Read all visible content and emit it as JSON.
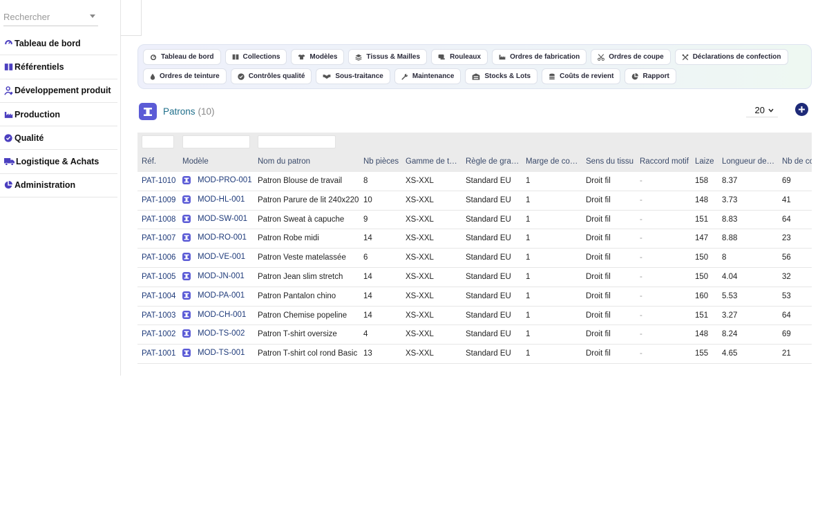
{
  "sidebar": {
    "search_placeholder": "Rechercher",
    "items": [
      {
        "label": "Tableau de bord",
        "icon": "gauge-icon"
      },
      {
        "label": "Référentiels",
        "icon": "book-icon"
      },
      {
        "label": "Développement produit",
        "icon": "user-gear-icon"
      },
      {
        "label": "Production",
        "icon": "industry-icon"
      },
      {
        "label": "Qualité",
        "icon": "check-circle-icon"
      },
      {
        "label": "Logistique & Achats",
        "icon": "truck-icon"
      },
      {
        "label": "Administration",
        "icon": "chart-pie-icon"
      }
    ]
  },
  "toolbar": {
    "row1": [
      {
        "label": "Tableau de bord",
        "icon": "gauge-icon"
      },
      {
        "label": "Collections",
        "icon": "book-icon"
      },
      {
        "label": "Modèles",
        "icon": "shirt-icon"
      },
      {
        "label": "Tissus & Mailles",
        "icon": "layers-icon"
      },
      {
        "label": "Rouleaux",
        "icon": "roll-icon"
      },
      {
        "label": "Ordres de fabrication",
        "icon": "industry-icon"
      },
      {
        "label": "Ordres de coupe",
        "icon": "scissors-icon"
      },
      {
        "label": "Déclarations de confection",
        "icon": "tools-icon"
      }
    ],
    "row2": [
      {
        "label": "Ordres de teinture",
        "icon": "droplet-icon"
      },
      {
        "label": "Contrôles qualité",
        "icon": "check-circle-icon"
      },
      {
        "label": "Sous-traitance",
        "icon": "handshake-icon"
      },
      {
        "label": "Maintenance",
        "icon": "wrench-icon"
      },
      {
        "label": "Stocks & Lots",
        "icon": "warehouse-icon"
      },
      {
        "label": "Coûts de revient",
        "icon": "coins-icon"
      },
      {
        "label": "Rapport",
        "icon": "chart-pie-icon"
      }
    ]
  },
  "page": {
    "title": "Patrons",
    "count": "(10)",
    "page_size": "20"
  },
  "table": {
    "headers": [
      "Réf.",
      "Modèle",
      "Nom du patron",
      "Nb pièces",
      "Gamme de t…",
      "Règle de gra…",
      "Marge de co…",
      "Sens du tissu",
      "Raccord motif",
      "Laize",
      "Longueur de…",
      "Nb de co"
    ],
    "rows": [
      [
        "PAT-1010",
        "MOD-PRO-001",
        "Patron Blouse de travail",
        "8",
        "XS-XXL",
        "Standard EU",
        "1",
        "Droit fil",
        "-",
        "158",
        "8.37",
        "69"
      ],
      [
        "PAT-1009",
        "MOD-HL-001",
        "Patron Parure de lit 240x220",
        "10",
        "XS-XXL",
        "Standard EU",
        "1",
        "Droit fil",
        "-",
        "148",
        "3.73",
        "41"
      ],
      [
        "PAT-1008",
        "MOD-SW-001",
        "Patron Sweat à capuche",
        "9",
        "XS-XXL",
        "Standard EU",
        "1",
        "Droit fil",
        "-",
        "151",
        "8.83",
        "64"
      ],
      [
        "PAT-1007",
        "MOD-RO-001",
        "Patron Robe midi",
        "14",
        "XS-XXL",
        "Standard EU",
        "1",
        "Droit fil",
        "-",
        "147",
        "8.88",
        "23"
      ],
      [
        "PAT-1006",
        "MOD-VE-001",
        "Patron Veste matelassée",
        "6",
        "XS-XXL",
        "Standard EU",
        "1",
        "Droit fil",
        "-",
        "150",
        "8",
        "56"
      ],
      [
        "PAT-1005",
        "MOD-JN-001",
        "Patron Jean slim stretch",
        "14",
        "XS-XXL",
        "Standard EU",
        "1",
        "Droit fil",
        "-",
        "150",
        "4.04",
        "32"
      ],
      [
        "PAT-1004",
        "MOD-PA-001",
        "Patron Pantalon chino",
        "14",
        "XS-XXL",
        "Standard EU",
        "1",
        "Droit fil",
        "-",
        "160",
        "5.53",
        "53"
      ],
      [
        "PAT-1003",
        "MOD-CH-001",
        "Patron Chemise popeline",
        "14",
        "XS-XXL",
        "Standard EU",
        "1",
        "Droit fil",
        "-",
        "151",
        "3.27",
        "64"
      ],
      [
        "PAT-1002",
        "MOD-TS-002",
        "Patron T-shirt oversize",
        "4",
        "XS-XXL",
        "Standard EU",
        "1",
        "Droit fil",
        "-",
        "148",
        "8.24",
        "69"
      ],
      [
        "PAT-1001",
        "MOD-TS-001",
        "Patron T-shirt col rond Basic",
        "13",
        "XS-XXL",
        "Standard EU",
        "1",
        "Droit fil",
        "-",
        "155",
        "4.65",
        "21"
      ]
    ]
  },
  "colors": {
    "accent": "#5b5bd6",
    "link": "#1e3a7a",
    "title": "#1f6f8b",
    "add_button": "#1e2a78"
  }
}
